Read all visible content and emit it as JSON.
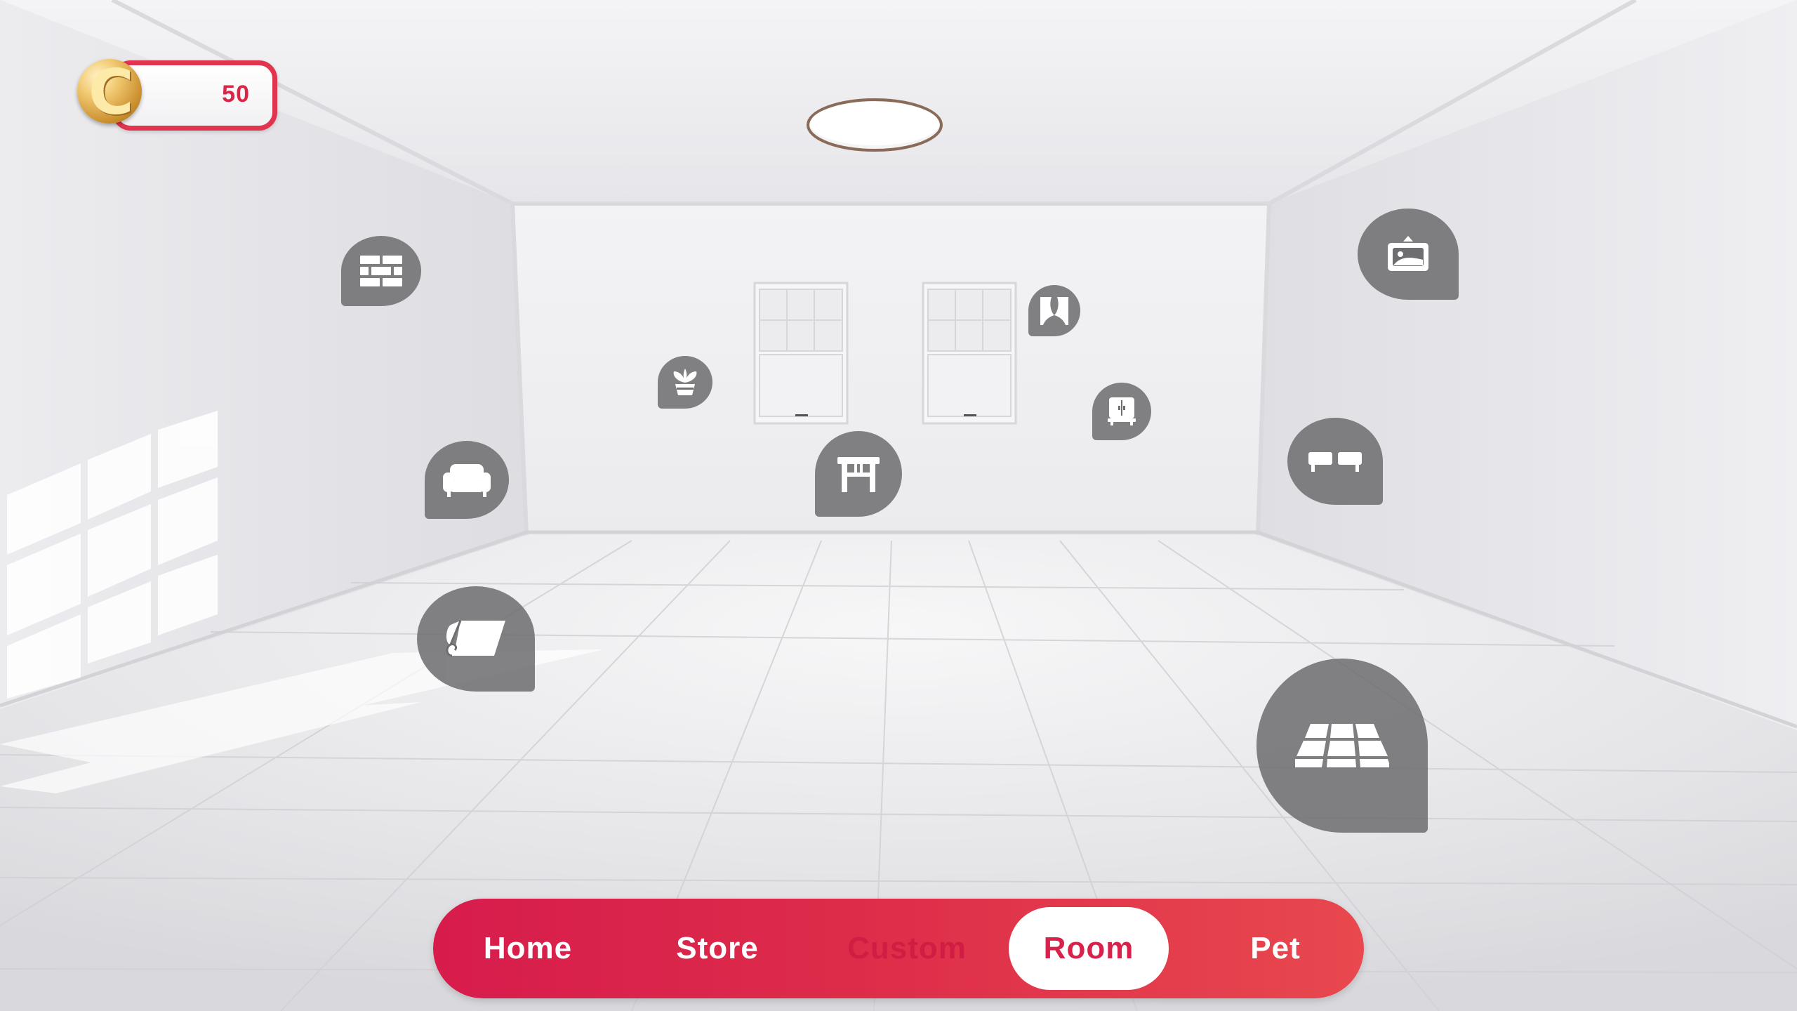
{
  "currency": {
    "amount": "50",
    "icon": "coin-icon",
    "accent": "#e0344f"
  },
  "room_markers": [
    {
      "id": "wall",
      "icon": "brick-wall-icon"
    },
    {
      "id": "plant",
      "icon": "potted-plant-icon"
    },
    {
      "id": "curtain",
      "icon": "curtain-icon"
    },
    {
      "id": "cabinet",
      "icon": "cabinet-icon"
    },
    {
      "id": "table",
      "icon": "table-icon"
    },
    {
      "id": "sofa",
      "icon": "sofa-icon"
    },
    {
      "id": "painting",
      "icon": "picture-frame-icon"
    },
    {
      "id": "shelf",
      "icon": "wall-shelf-icon"
    },
    {
      "id": "rug",
      "icon": "rug-icon"
    },
    {
      "id": "floor",
      "icon": "floor-tiles-icon"
    }
  ],
  "nav": {
    "tabs": [
      {
        "label": "Home",
        "state": "normal"
      },
      {
        "label": "Store",
        "state": "normal"
      },
      {
        "label": "Custom",
        "state": "disabled"
      },
      {
        "label": "Room",
        "state": "active"
      },
      {
        "label": "Pet",
        "state": "normal"
      }
    ],
    "colors": {
      "bar": "#dd2c4a",
      "active_bg": "#ffffff",
      "active_text": "#d7234b",
      "disabled_text": "#d01d43"
    }
  }
}
